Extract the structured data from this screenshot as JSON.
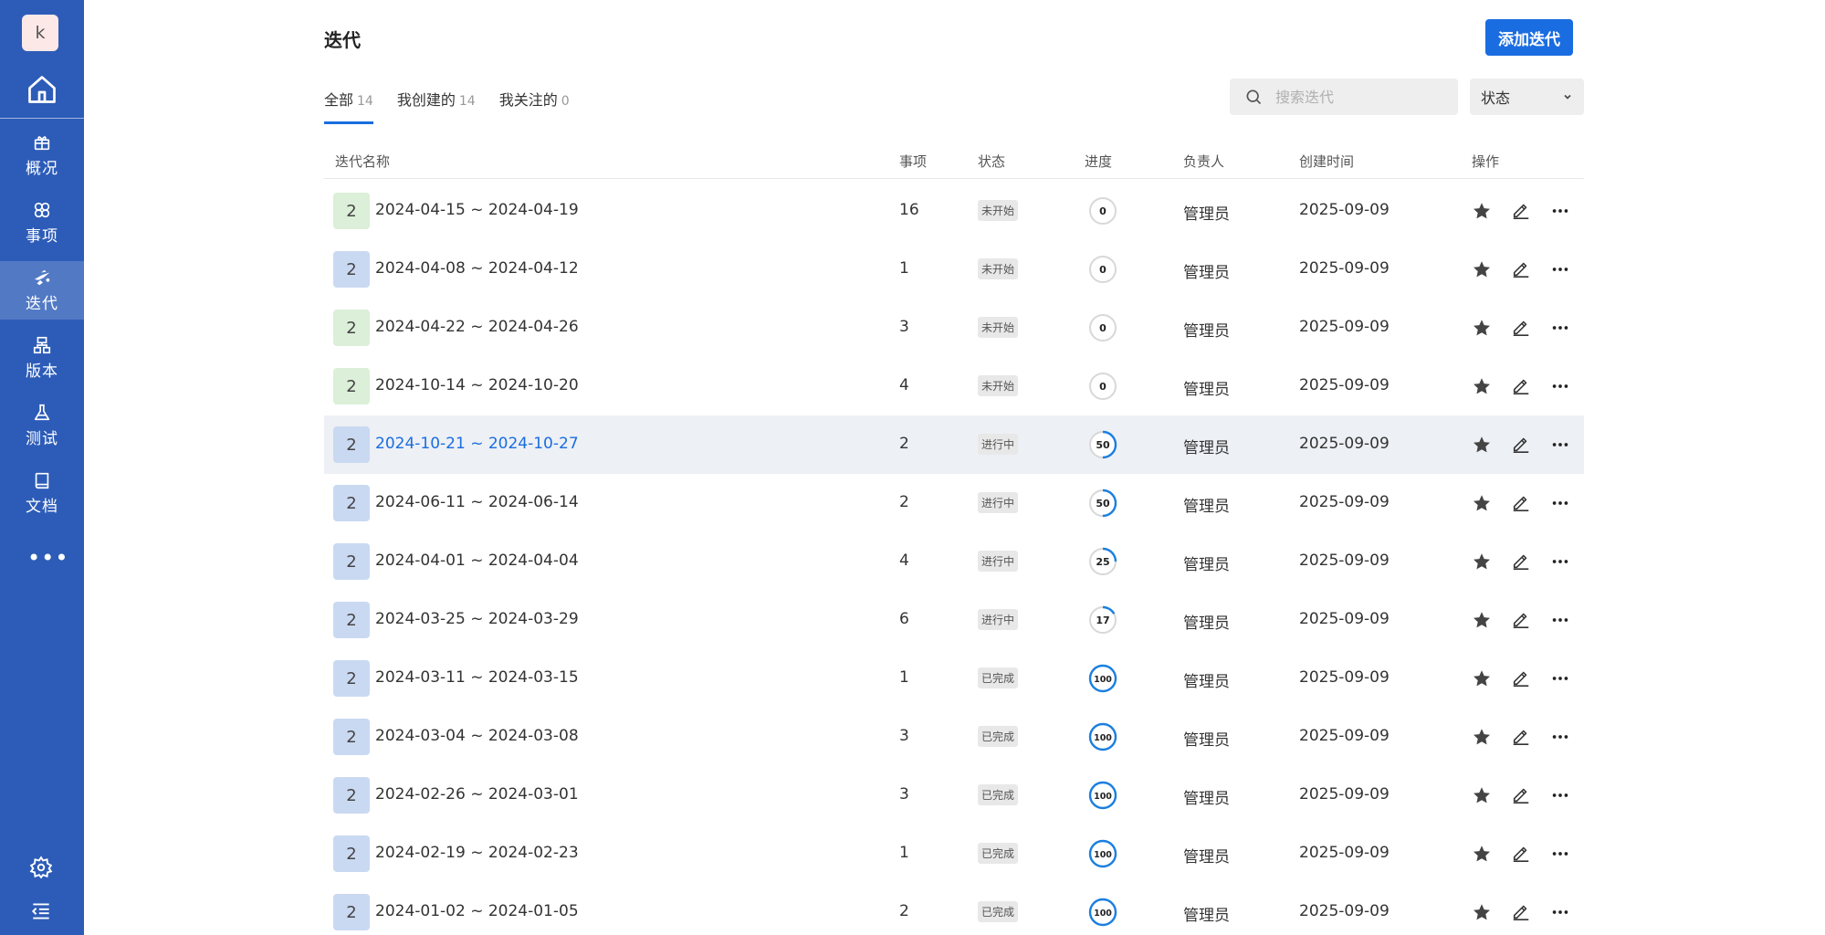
{
  "sidebar": {
    "avatar_letter": "k",
    "items": [
      {
        "label": "概况",
        "icon": "overview-icon"
      },
      {
        "label": "事项",
        "icon": "items-icon"
      },
      {
        "label": "迭代",
        "icon": "iteration-icon"
      },
      {
        "label": "版本",
        "icon": "version-icon"
      },
      {
        "label": "测试",
        "icon": "test-flask-icon"
      },
      {
        "label": "文档",
        "icon": "document-icon"
      }
    ],
    "active_item": "迭代",
    "more_label": "•••"
  },
  "header": {
    "title": "迭代",
    "add_button": "添加迭代"
  },
  "tabs": [
    {
      "label": "全部",
      "count": "14"
    },
    {
      "label": "我创建的",
      "count": "14"
    },
    {
      "label": "我关注的",
      "count": "0"
    }
  ],
  "search": {
    "placeholder": "搜索迭代"
  },
  "filter": {
    "status_label": "状态"
  },
  "table": {
    "columns": [
      "迭代名称",
      "事项",
      "状态",
      "进度",
      "负责人",
      "创建时间",
      "操作"
    ],
    "rows": [
      {
        "badge": "2",
        "name": "2024-04-15 ~ 2024-04-19",
        "count": "16",
        "state": "未开始",
        "progress": "0",
        "owner": "管理员",
        "created": "2025-09-09"
      },
      {
        "badge": "2",
        "name": "2024-04-08 ~ 2024-04-12",
        "count": "1",
        "state": "未开始",
        "progress": "0",
        "owner": "管理员",
        "created": "2025-09-09"
      },
      {
        "badge": "2",
        "name": "2024-04-22 ~ 2024-04-26",
        "count": "3",
        "state": "未开始",
        "progress": "0",
        "owner": "管理员",
        "created": "2025-09-09"
      },
      {
        "badge": "2",
        "name": "2024-10-14 ~ 2024-10-20",
        "count": "4",
        "state": "未开始",
        "progress": "0",
        "owner": "管理员",
        "created": "2025-09-09"
      },
      {
        "badge": "2",
        "name": "2024-10-21 ~ 2024-10-27",
        "count": "2",
        "state": "进行中",
        "progress": "50",
        "owner": "管理员",
        "created": "2025-09-09"
      },
      {
        "badge": "2",
        "name": "2024-06-11 ~ 2024-06-14",
        "count": "2",
        "state": "进行中",
        "progress": "50",
        "owner": "管理员",
        "created": "2025-09-09"
      },
      {
        "badge": "2",
        "name": "2024-04-01 ~ 2024-04-04",
        "count": "4",
        "state": "进行中",
        "progress": "25",
        "owner": "管理员",
        "created": "2025-09-09"
      },
      {
        "badge": "2",
        "name": "2024-03-25 ~ 2024-03-29",
        "count": "6",
        "state": "进行中",
        "progress": "17",
        "owner": "管理员",
        "created": "2025-09-09"
      },
      {
        "badge": "2",
        "name": "2024-03-11 ~ 2024-03-15",
        "count": "1",
        "state": "已完成",
        "progress": "100",
        "owner": "管理员",
        "created": "2025-09-09"
      },
      {
        "badge": "2",
        "name": "2024-03-04 ~ 2024-03-08",
        "count": "3",
        "state": "已完成",
        "progress": "100",
        "owner": "管理员",
        "created": "2025-09-09"
      },
      {
        "badge": "2",
        "name": "2024-02-26 ~ 2024-03-01",
        "count": "3",
        "state": "已完成",
        "progress": "100",
        "owner": "管理员",
        "created": "2025-09-09"
      },
      {
        "badge": "2",
        "name": "2024-02-19 ~ 2024-02-23",
        "count": "1",
        "state": "已完成",
        "progress": "100",
        "owner": "管理员",
        "created": "2025-09-09"
      },
      {
        "badge": "2",
        "name": "2024-01-02 ~ 2024-01-05",
        "count": "2",
        "state": "已完成",
        "progress": "100",
        "owner": "管理员",
        "created": "2025-09-09"
      }
    ]
  },
  "colors": {
    "sidebar_bg": "#2d5cb8",
    "accent": "#1a6de0",
    "badge_green": "#dcefd8",
    "badge_blue": "#cad9f2",
    "row_highlight": "#edf0f5"
  }
}
